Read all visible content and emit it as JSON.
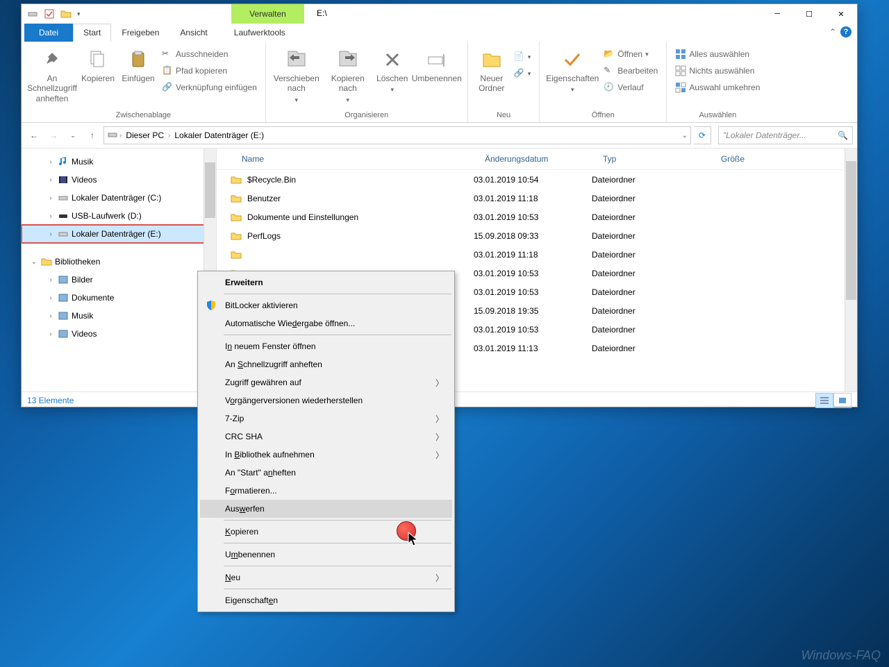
{
  "window": {
    "contextual_tab": "Verwalten",
    "title": "E:\\",
    "tabs": {
      "file": "Datei",
      "start": "Start",
      "freigeben": "Freigeben",
      "ansicht": "Ansicht",
      "drivetools": "Laufwerktools"
    }
  },
  "ribbon": {
    "clipboard": {
      "pin": "An Schnellzugriff anheften",
      "copy": "Kopieren",
      "paste": "Einfügen",
      "cut": "Ausschneiden",
      "copypath": "Pfad kopieren",
      "pastelink": "Verknüpfung einfügen",
      "label": "Zwischenablage"
    },
    "organize": {
      "moveto": "Verschieben nach",
      "copyto": "Kopieren nach",
      "delete": "Löschen",
      "rename": "Umbenennen",
      "label": "Organisieren"
    },
    "new": {
      "newfolder": "Neuer Ordner",
      "label": "Neu"
    },
    "open": {
      "properties": "Eigenschaften",
      "open": "Öffnen",
      "edit": "Bearbeiten",
      "history": "Verlauf",
      "label": "Öffnen"
    },
    "select": {
      "all": "Alles auswählen",
      "none": "Nichts auswählen",
      "invert": "Auswahl umkehren",
      "label": "Auswählen"
    }
  },
  "breadcrumb": {
    "pc": "Dieser PC",
    "drive": "Lokaler Datenträger (E:)"
  },
  "search": {
    "placeholder": "\"Lokaler Datenträger..."
  },
  "tree": {
    "items": [
      {
        "label": "Musik",
        "icon": "music"
      },
      {
        "label": "Videos",
        "icon": "video"
      },
      {
        "label": "Lokaler Datenträger (C:)",
        "icon": "drive"
      },
      {
        "label": "USB-Laufwerk (D:)",
        "icon": "usb"
      },
      {
        "label": "Lokaler Datenträger (E:)",
        "icon": "drive",
        "selected": true,
        "highlight": true
      }
    ],
    "lib": "Bibliotheken",
    "libs": [
      {
        "label": "Bilder"
      },
      {
        "label": "Dokumente"
      },
      {
        "label": "Musik"
      },
      {
        "label": "Videos"
      }
    ]
  },
  "columns": {
    "name": "Name",
    "date": "Änderungsdatum",
    "type": "Typ",
    "size": "Größe"
  },
  "files": [
    {
      "name": "$Recycle.Bin",
      "date": "03.01.2019 10:54",
      "type": "Dateiordner"
    },
    {
      "name": "Benutzer",
      "date": "03.01.2019 11:18",
      "type": "Dateiordner"
    },
    {
      "name": "Dokumente und Einstellungen",
      "date": "03.01.2019 10:53",
      "type": "Dateiordner"
    },
    {
      "name": "PerfLogs",
      "date": "15.09.2018 09:33",
      "type": "Dateiordner"
    },
    {
      "name": "",
      "date": "03.01.2019 11:18",
      "type": "Dateiordner"
    },
    {
      "name": "",
      "date": "03.01.2019 10:53",
      "type": "Dateiordner"
    },
    {
      "name": "",
      "date": "03.01.2019 10:53",
      "type": "Dateiordner"
    },
    {
      "name": "",
      "date": "15.09.2018 19:35",
      "type": "Dateiordner"
    },
    {
      "name": "",
      "date": "03.01.2019 10:53",
      "type": "Dateiordner"
    },
    {
      "name": "",
      "date": "03.01.2019 11:13",
      "type": "Dateiordner"
    }
  ],
  "statusbar": {
    "count": "13 Elemente"
  },
  "contextmenu": {
    "items": [
      {
        "label": "Erweitern",
        "bold": true
      },
      {
        "sep": true
      },
      {
        "label": "BitLocker aktivieren",
        "icon": "shield"
      },
      {
        "label": "Automatische Wiedergabe öffnen..."
      },
      {
        "sep": true
      },
      {
        "label": "In neuem Fenster öffnen"
      },
      {
        "label": "An Schnellzugriff anheften"
      },
      {
        "label": "Zugriff gewähren auf",
        "arrow": true
      },
      {
        "label": "Vorgängerversionen wiederherstellen"
      },
      {
        "label": "7-Zip",
        "arrow": true
      },
      {
        "label": "CRC SHA",
        "arrow": true
      },
      {
        "label": "In Bibliothek aufnehmen",
        "arrow": true
      },
      {
        "label": "An \"Start\" anheften"
      },
      {
        "label": "Formatieren..."
      },
      {
        "label": "Auswerfen",
        "hover": true
      },
      {
        "sep": true
      },
      {
        "label": "Kopieren"
      },
      {
        "sep": true
      },
      {
        "label": "Umbenennen"
      },
      {
        "sep": true
      },
      {
        "label": "Neu",
        "arrow": true
      },
      {
        "sep": true
      },
      {
        "label": "Eigenschaften"
      }
    ]
  },
  "watermark": "Windows-FAQ"
}
